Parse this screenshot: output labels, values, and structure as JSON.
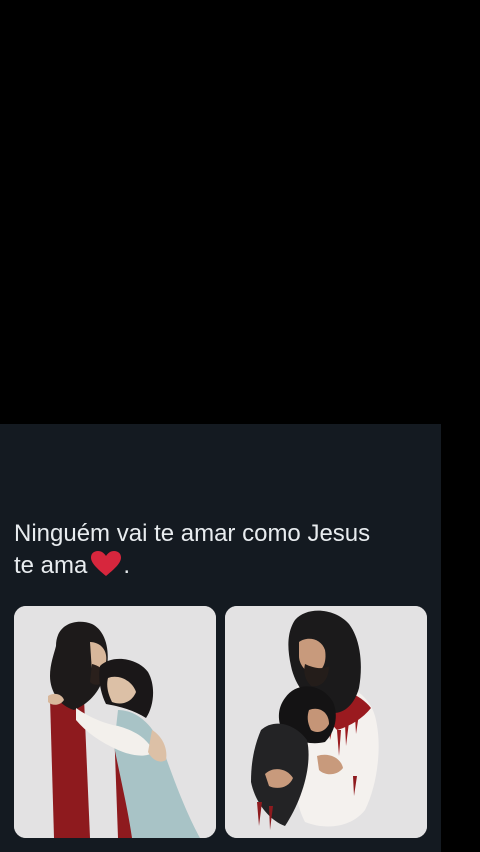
{
  "post": {
    "text_line1": "Ninguém vai te amar como Jesus",
    "text_line2": "te ama",
    "text_after_emoji": ".",
    "emoji": "heart-icon"
  },
  "colors": {
    "background": "#000000",
    "card": "#141a21",
    "text": "#e8ecef",
    "heart": "#d7263d",
    "robe_red": "#8e1a1e",
    "image_bg": "#e3e2e3"
  },
  "images": [
    {
      "name": "illustration-jesus-hugging-girl"
    },
    {
      "name": "illustration-jesus-embracing-person"
    }
  ]
}
